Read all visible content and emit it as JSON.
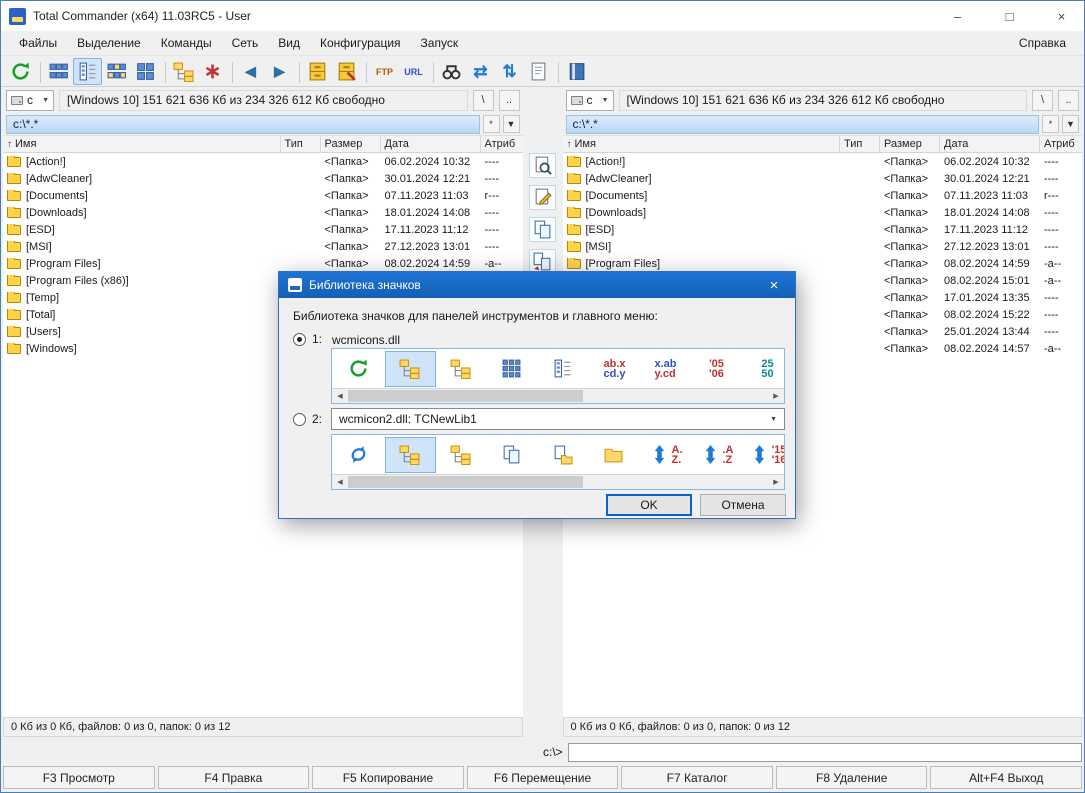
{
  "window": {
    "title": "Total Commander (x64) 11.03RC5 - User"
  },
  "ui": {
    "minimize": "–",
    "maximize": "□",
    "close": "×",
    "combo_arrow": "▼",
    "root": "\\",
    "up": "..",
    "star": "*",
    "hist": "▼",
    "scroll_left": "◀",
    "scroll_right": "▶"
  },
  "menu": {
    "items": [
      "Файлы",
      "Выделение",
      "Команды",
      "Сеть",
      "Вид",
      "Конфигурация",
      "Запуск"
    ],
    "help": "Справка"
  },
  "toolbar": {
    "items": [
      {
        "name": "refresh-button",
        "icon": "refresh_green"
      },
      {
        "name": "toolbar-separator",
        "cls": "sep"
      },
      {
        "name": "brief-view-button",
        "icon": "grid6"
      },
      {
        "name": "full-view-button",
        "icon": "listcol",
        "cls": "pressed"
      },
      {
        "name": "thumbnails-view-button",
        "icon": "grid6b"
      },
      {
        "name": "custom-columns-button",
        "icon": "grid4"
      },
      {
        "name": "toolbar-separator",
        "cls": "sep"
      },
      {
        "name": "tree-view-button",
        "icon": "tree"
      },
      {
        "name": "quick-filter-button",
        "icon": "asterisk"
      },
      {
        "name": "toolbar-separator",
        "cls": "sep"
      },
      {
        "name": "back-button",
        "icon": "back"
      },
      {
        "name": "forward-button",
        "icon": "forward"
      },
      {
        "name": "toolbar-separator",
        "cls": "sep"
      },
      {
        "name": "pack-files-button",
        "icon": "cabinet"
      },
      {
        "name": "unpack-files-button",
        "icon": "cabinet2"
      },
      {
        "name": "toolbar-separator",
        "cls": "sep"
      },
      {
        "name": "ftp-connect-button",
        "icon": "ftp"
      },
      {
        "name": "ftp-url-button",
        "icon": "url"
      },
      {
        "name": "toolbar-separator",
        "cls": "sep"
      },
      {
        "name": "search-button",
        "icon": "binoculars"
      },
      {
        "name": "compare-contents-button",
        "icon": "compare"
      },
      {
        "name": "sync-dirs-button",
        "icon": "sync"
      },
      {
        "name": "multi-rename-button",
        "icon": "notepad"
      },
      {
        "name": "toolbar-separator",
        "cls": "sep"
      },
      {
        "name": "notes-button",
        "icon": "book"
      }
    ]
  },
  "middle_buttons": [
    {
      "name": "view-file-button",
      "icon": "page_mag"
    },
    {
      "name": "edit-file-button",
      "icon": "page_pen"
    },
    {
      "name": "copy-files-button",
      "icon": "docs"
    },
    {
      "name": "move-files-button",
      "icon": "docs_arrow"
    }
  ],
  "panels": {
    "left": {
      "drive": "c",
      "info": "[Windows 10] 151 621 636 Кб из 234 326 612 Кб свободно",
      "path": "c:\\*.*",
      "status": "0 Кб из 0 Кб, файлов: 0 из 0, папок: 0 из 12"
    },
    "right": {
      "drive": "c",
      "info": "[Windows 10] 151 621 636 Кб из 234 326 612 Кб свободно",
      "path": "c:\\*.*",
      "status": "0 Кб из 0 Кб, файлов: 0 из 0, папок: 0 из 12"
    }
  },
  "files": {
    "columns": [
      {
        "label": "Имя",
        "sort": "↑",
        "cls": "col-name"
      },
      {
        "label": "Тип",
        "cls": "col-type"
      },
      {
        "label": "Размер",
        "cls": "col-size"
      },
      {
        "label": "Дата",
        "cls": "col-date"
      },
      {
        "label": "Атриб",
        "cls": "col-attr"
      }
    ],
    "rows": [
      {
        "name": "[Action!]",
        "size": "<Папка>",
        "date": "06.02.2024 10:32",
        "attr": "----"
      },
      {
        "name": "[AdwCleaner]",
        "size": "<Папка>",
        "date": "30.01.2024 12:21",
        "attr": "----"
      },
      {
        "name": "[Documents]",
        "size": "<Папка>",
        "date": "07.11.2023 11:03",
        "attr": "r---"
      },
      {
        "name": "[Downloads]",
        "size": "<Папка>",
        "date": "18.01.2024 14:08",
        "attr": "----"
      },
      {
        "name": "[ESD]",
        "size": "<Папка>",
        "date": "17.11.2023 11:12",
        "attr": "----"
      },
      {
        "name": "[MSI]",
        "size": "<Папка>",
        "date": "27.12.2023 13:01",
        "attr": "----"
      },
      {
        "name": "[Program Files]",
        "size": "<Папка>",
        "date": "08.02.2024 14:59",
        "attr": "-a--"
      },
      {
        "name": "[Program Files (x86)]",
        "size": "<Папка>",
        "date": "08.02.2024 15:01",
        "attr": "-a--"
      },
      {
        "name": "[Temp]",
        "size": "<Папка>",
        "date": "17.01.2024 13:35",
        "attr": "----"
      },
      {
        "name": "[Total]",
        "size": "<Папка>",
        "date": "08.02.2024 15:22",
        "attr": "----"
      },
      {
        "name": "[Users]",
        "size": "<Папка>",
        "date": "25.01.2024 13:44",
        "attr": "----"
      },
      {
        "name": "[Windows]",
        "size": "<Папка>",
        "date": "08.02.2024 14:57",
        "attr": "-a--"
      }
    ]
  },
  "dialog": {
    "title": "Библиотека значков",
    "label": "Библиотека значков для панелей инструментов и главного меню:",
    "radio1": "1:",
    "lib1": "wcmicons.dll",
    "radio2": "2:",
    "lib2": "wcmicon2.dll: TCNewLib1",
    "ok": "OK",
    "cancel": "Отмена",
    "strip1": {
      "icons": [
        {
          "name": "refresh-icon",
          "icon": "refresh_green"
        },
        {
          "name": "tree-view-icon-selected",
          "icon": "tree",
          "cls": "sel"
        },
        {
          "name": "tree-view-icon",
          "icon": "tree"
        },
        {
          "name": "icons-view-icon",
          "icon": "grid9"
        },
        {
          "name": "list-view-icon",
          "icon": "listcol"
        },
        {
          "name": "sort-ext-icon",
          "lines": [
            "ab.x",
            "cd.y"
          ],
          "cls": "c-rb"
        },
        {
          "name": "sort-ext-reverse-icon",
          "lines": [
            "x.ab",
            "y.cd"
          ],
          "cls": "c-br"
        },
        {
          "name": "sort-year-icon",
          "lines": [
            "'05",
            "'06"
          ],
          "cls": "c-rr"
        },
        {
          "name": "sort-size-icon",
          "lines": [
            "25",
            "50"
          ],
          "cls": "c-tt"
        }
      ]
    },
    "strip2": {
      "icons": [
        {
          "name": "refresh-icon",
          "icon": "refresh_blue"
        },
        {
          "name": "tree-view-icon-selected",
          "icon": "tree",
          "cls": "sel"
        },
        {
          "name": "tree-view-icon",
          "icon": "tree"
        },
        {
          "name": "copy-docs-icon",
          "icon": "docs"
        },
        {
          "name": "doc-folder-icon",
          "icon": "page_folder"
        },
        {
          "name": "folder-icon",
          "icon": "folder"
        },
        {
          "name": "sort-name-icon",
          "icon": "updown",
          "lines": [
            "A.",
            "Z."
          ],
          "cls": "c-rr"
        },
        {
          "name": "sort-ext-icon",
          "icon": "updown",
          "lines": [
            ".A",
            ".Z"
          ],
          "cls": "c-rr"
        },
        {
          "name": "sort-date-icon",
          "icon": "updown",
          "lines": [
            "'15",
            "'16"
          ],
          "cls": "c-rr"
        },
        {
          "name": "sort-size-icon",
          "icon": "updown"
        }
      ]
    }
  },
  "command_line": {
    "prompt": "c:\\>"
  },
  "function_keys": [
    {
      "label": "F3 Просмотр"
    },
    {
      "label": "F4 Правка"
    },
    {
      "label": "F5 Копирование"
    },
    {
      "label": "F6 Перемещение"
    },
    {
      "label": "F7 Каталог"
    },
    {
      "label": "F8 Удаление"
    },
    {
      "label": "Alt+F4 Выход"
    }
  ]
}
